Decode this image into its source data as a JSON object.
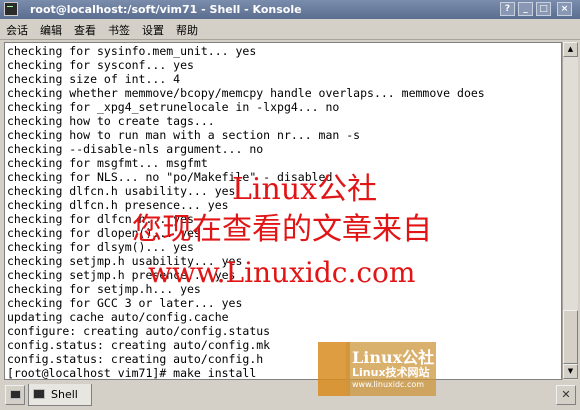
{
  "window": {
    "title": "root@localhost:/soft/vim71 - Shell - Konsole",
    "buttons": [
      "?",
      "_",
      "□",
      "×"
    ]
  },
  "menu": [
    "会话",
    "编辑",
    "查看",
    "书签",
    "设置",
    "帮助"
  ],
  "terminal": {
    "lines": [
      "checking for sysinfo.mem_unit... yes",
      "checking for sysconf... yes",
      "checking size of int... 4",
      "checking whether memmove/bcopy/memcpy handle overlaps... memmove does",
      "checking for _xpg4_setrunelocale in -lxpg4... no",
      "checking how to create tags...",
      "checking how to run man with a section nr... man -s",
      "checking --disable-nls argument... no",
      "checking for msgfmt... msgfmt",
      "checking for NLS... no \"po/Makefile\" - disabled",
      "checking dlfcn.h usability... yes",
      "checking dlfcn.h presence... yes",
      "checking for dlfcn.h... yes",
      "checking for dlopen()... yes",
      "checking for dlsym()... yes",
      "checking setjmp.h usability... yes",
      "checking setjmp.h presence... yes",
      "checking for setjmp.h... yes",
      "checking for GCC 3 or later... yes",
      "updating cache auto/config.cache",
      "configure: creating auto/config.status",
      "config.status: creating auto/config.mk",
      "config.status: creating auto/config.h",
      "[root@localhost vim71]# make install"
    ]
  },
  "tabs": [
    {
      "label": "Shell"
    }
  ],
  "watermark": {
    "line1": "Linux公社",
    "line2": "您现在查看的文章来自",
    "line3": "www.Linuxidc.com",
    "logo_title": "Linux公社",
    "logo_subtitle": "Linux技术网站",
    "logo_url": "www.linuxidc.com"
  },
  "colors": {
    "titlebar": "#6a7c9e",
    "watermark": "#e11515"
  }
}
